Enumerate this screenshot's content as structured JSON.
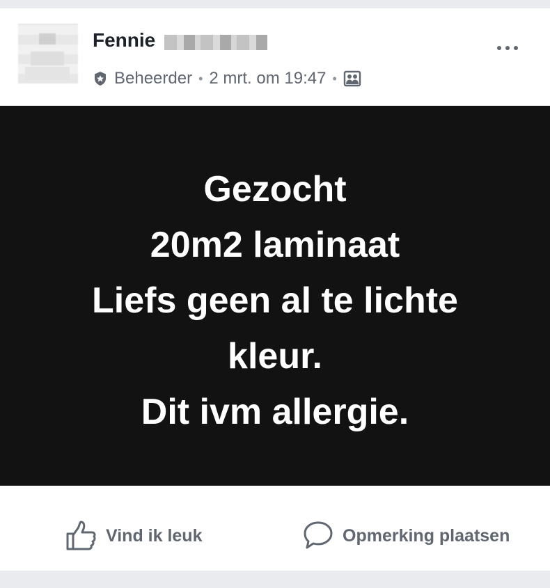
{
  "post": {
    "author": "Fennie",
    "role": "Beheerder",
    "timestamp": "2 mrt. om 19:47",
    "separator": "•",
    "icons": {
      "role": "admin-badge-icon",
      "audience": "group-audience-icon",
      "more": "more-options-icon",
      "like": "thumbs-up-icon",
      "comment": "speech-bubble-icon"
    },
    "content_lines": [
      "Gezocht",
      "20m2 laminaat",
      "Liefs geen al te lichte",
      "kleur.",
      "Dit ivm allergie."
    ],
    "colors": {
      "background": "#121212",
      "text": "#ffffff",
      "secondary_text": "#606770"
    }
  },
  "actions": {
    "like_label": "Vind ik leuk",
    "comment_label": "Opmerking plaatsen"
  }
}
